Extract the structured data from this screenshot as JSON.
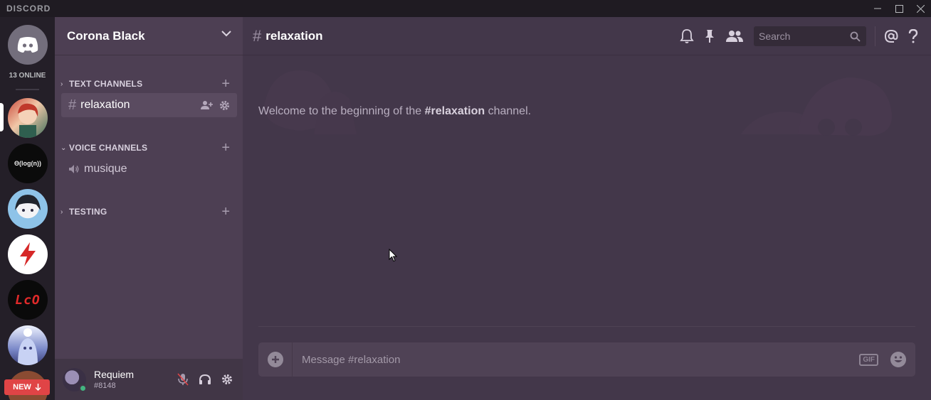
{
  "titlebar": {
    "brand": "DISCORD"
  },
  "rail": {
    "online_label": "13 ONLINE",
    "servers": [
      {
        "id": "anime-red",
        "label": ""
      },
      {
        "id": "theta",
        "label": "Θ(log(n))"
      },
      {
        "id": "anime-blue",
        "label": ""
      },
      {
        "id": "bolt",
        "label": ""
      },
      {
        "id": "lco",
        "label": "LcO"
      },
      {
        "id": "ghost",
        "label": ""
      }
    ],
    "new_badge": "NEW"
  },
  "guild": {
    "name": "Corona Black"
  },
  "categories": {
    "text": {
      "label": "TEXT CHANNELS"
    },
    "voice": {
      "label": "VOICE CHANNELS"
    },
    "testing": {
      "label": "TESTING"
    }
  },
  "channels": {
    "text": [
      {
        "name": "relaxation"
      }
    ],
    "voice": [
      {
        "name": "musique"
      }
    ]
  },
  "user": {
    "name": "Requiem",
    "discriminator": "#8148"
  },
  "main": {
    "channel_title": "relaxation",
    "search_placeholder": "Search",
    "welcome_prefix": "Welcome to the beginning of the ",
    "welcome_channel": "#relaxation",
    "welcome_suffix": " channel.",
    "composer_placeholder": "Message #relaxation",
    "gif_label": "GIF"
  },
  "colors": {
    "accent_online": "#43b581",
    "new_badge": "#e04446",
    "sidebar": "#4d3f53",
    "main": "#43374a"
  }
}
